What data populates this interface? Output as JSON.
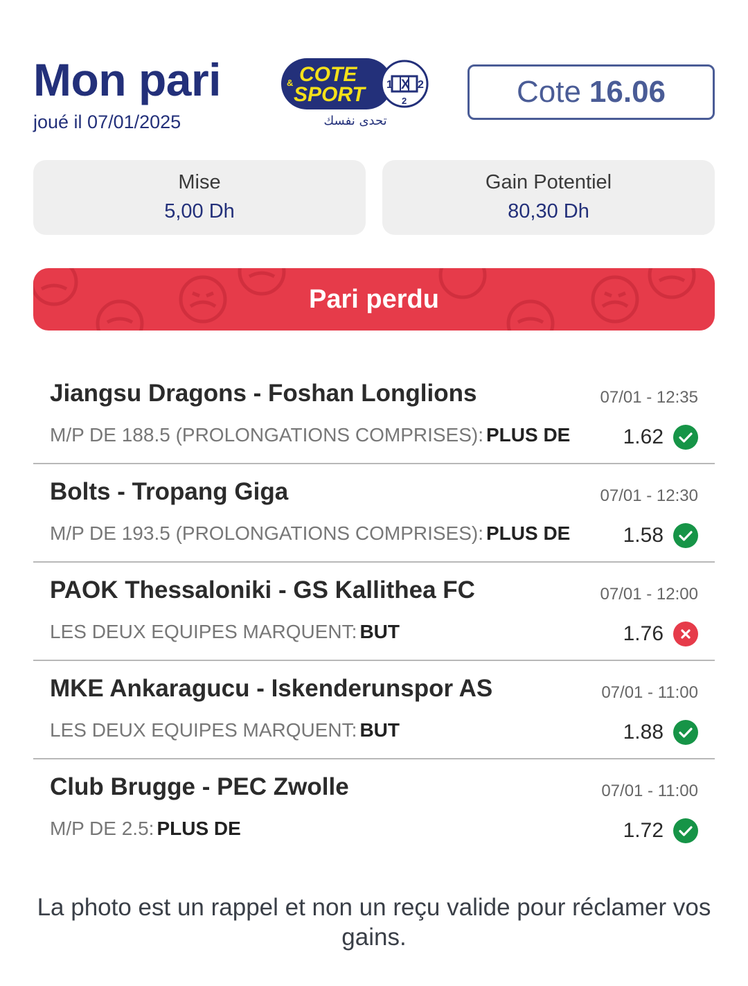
{
  "header": {
    "title": "Mon pari",
    "played_on": "joué il 07/01/2025",
    "logo": {
      "line1": "COTE",
      "line2": "SPORT",
      "amp": "&",
      "grid": [
        "1",
        "X",
        "2",
        "2"
      ],
      "arabic": "تحدى نفسك"
    },
    "odds_label": "Cote",
    "odds_value": "16.06"
  },
  "stats": {
    "stake_label": "Mise",
    "stake_value": "5,00 Dh",
    "gain_label": "Gain Potentiel",
    "gain_value": "80,30 Dh"
  },
  "status": {
    "label": "Pari perdu",
    "color": "#e63b4a"
  },
  "bets": [
    {
      "match": "Jiangsu Dragons - Foshan Longlions",
      "time": "07/01 - 12:35",
      "market": "M/P DE 188.5 (PROLONGATIONS COMPRISES):",
      "selection": "PLUS DE",
      "odd": "1.62",
      "result_icon": "check-icon"
    },
    {
      "match": "Bolts - Tropang Giga",
      "time": "07/01 - 12:30",
      "market": "M/P DE 193.5 (PROLONGATIONS COMPRISES):",
      "selection": "PLUS DE",
      "odd": "1.58",
      "result_icon": "check-icon"
    },
    {
      "match": "PAOK Thessaloniki - GS Kallithea FC",
      "time": "07/01 - 12:00",
      "market": "LES DEUX EQUIPES MARQUENT:",
      "selection": "BUT",
      "odd": "1.76",
      "result_icon": "cross-icon"
    },
    {
      "match": "MKE Ankaragucu - Iskenderunspor AS",
      "time": "07/01 - 11:00",
      "market": "LES DEUX EQUIPES MARQUENT:",
      "selection": "BUT",
      "odd": "1.88",
      "result_icon": "check-icon"
    },
    {
      "match": "Club Brugge - PEC Zwolle",
      "time": "07/01 - 11:00",
      "market": "M/P DE 2.5:",
      "selection": "PLUS DE",
      "odd": "1.72",
      "result_icon": "check-icon"
    }
  ],
  "disclaimer": "La photo est un rappel et non un reçu valide pour réclamer vos gains.",
  "colors": {
    "brand_navy": "#23307a",
    "won_green": "#169447",
    "lost_red": "#e63b4a",
    "logo_yellow": "#f5e11a"
  }
}
